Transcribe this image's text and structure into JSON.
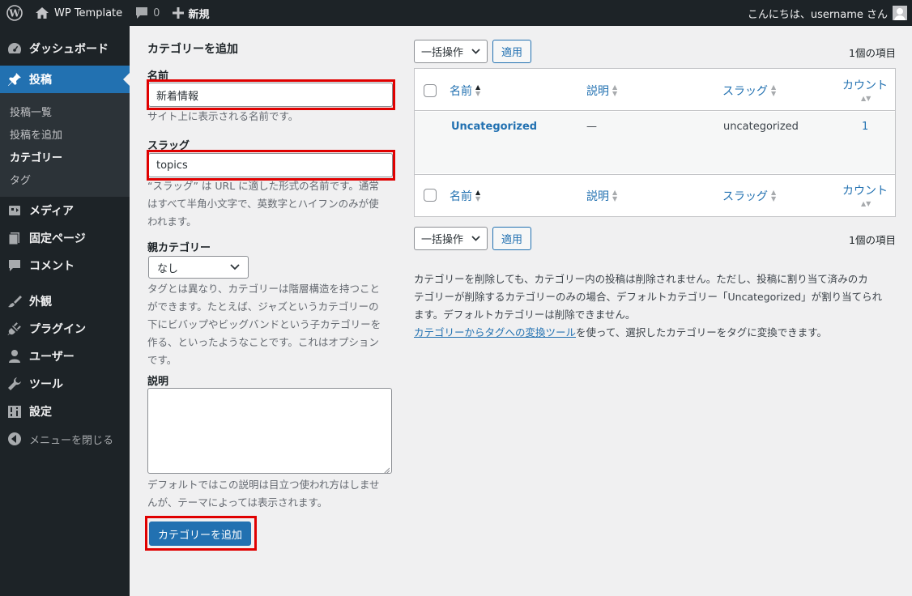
{
  "adminbar": {
    "site_name": "WP Template",
    "comment_count": "0",
    "new_label": "新規",
    "greeting": "こんにちは、username さん"
  },
  "sidebar": {
    "items": [
      {
        "label": "ダッシュボード",
        "icon": "dashboard-icon"
      },
      {
        "label": "投稿",
        "icon": "pushpin-icon",
        "current": true
      },
      {
        "label": "メディア",
        "icon": "media-icon"
      },
      {
        "label": "固定ページ",
        "icon": "page-icon"
      },
      {
        "label": "コメント",
        "icon": "comment-icon"
      },
      {
        "label": "外観",
        "icon": "paintbrush-icon"
      },
      {
        "label": "プラグイン",
        "icon": "plugin-icon"
      },
      {
        "label": "ユーザー",
        "icon": "user-icon"
      },
      {
        "label": "ツール",
        "icon": "wrench-icon"
      },
      {
        "label": "設定",
        "icon": "settings-icon"
      }
    ],
    "submenu": [
      "投稿一覧",
      "投稿を追加",
      "カテゴリー",
      "タグ"
    ],
    "collapse_label": "メニューを閉じる"
  },
  "form": {
    "title": "カテゴリーを追加",
    "name_label": "名前",
    "name_value": "新着情報",
    "name_help": "サイト上に表示される名前です。",
    "slug_label": "スラッグ",
    "slug_value": "topics",
    "slug_help_1": "“スラッグ” は URL に適した形式の名前です。通常",
    "slug_help_2": "はすべて半角小文字で、英数字とハイフンのみが使",
    "slug_help_3": "われます。",
    "parent_label": "親カテゴリー",
    "parent_value": "なし",
    "parent_help_1": "タグとは異なり、カテゴリーは階層構造を持つこと",
    "parent_help_2": "ができます。たとえば、ジャズというカテゴリーの",
    "parent_help_3": "下にビバップやビッグバンドという子カテゴリーを",
    "parent_help_4": "作る、といったようなことです。これはオプション",
    "parent_help_5": "です。",
    "desc_label": "説明",
    "desc_help_1": "デフォルトではこの説明は目立つ使われ方はしませ",
    "desc_help_2": "んが、テーマによっては表示されます。",
    "submit_label": "カテゴリーを追加"
  },
  "list": {
    "bulk_label": "一括操作",
    "apply_label": "適用",
    "item_count": "1個の項目",
    "columns": {
      "name": "名前",
      "description": "説明",
      "slug": "スラッグ",
      "count": "カウント"
    },
    "rows": [
      {
        "name": "Uncategorized",
        "description": "—",
        "slug": "uncategorized",
        "count": "1"
      }
    ]
  },
  "notes": {
    "line1": "カテゴリーを削除しても、カテゴリー内の投稿は削除されません。ただし、投稿に割り当て済みのカ",
    "line2": "テゴリーが削除するカテゴリーのみの場合、デフォルトカテゴリー「Uncategorized」が割り当てられ",
    "line3": "ます。デフォルトカテゴリーは削除できません。",
    "tool_link": "カテゴリーからタグへの変換ツール",
    "line4_rest": "を使って、選択したカテゴリーをタグに変換できます。"
  },
  "colors": {
    "accent": "#2271b1",
    "highlight": "#e00000",
    "sidebar_bg": "#1d2327"
  }
}
